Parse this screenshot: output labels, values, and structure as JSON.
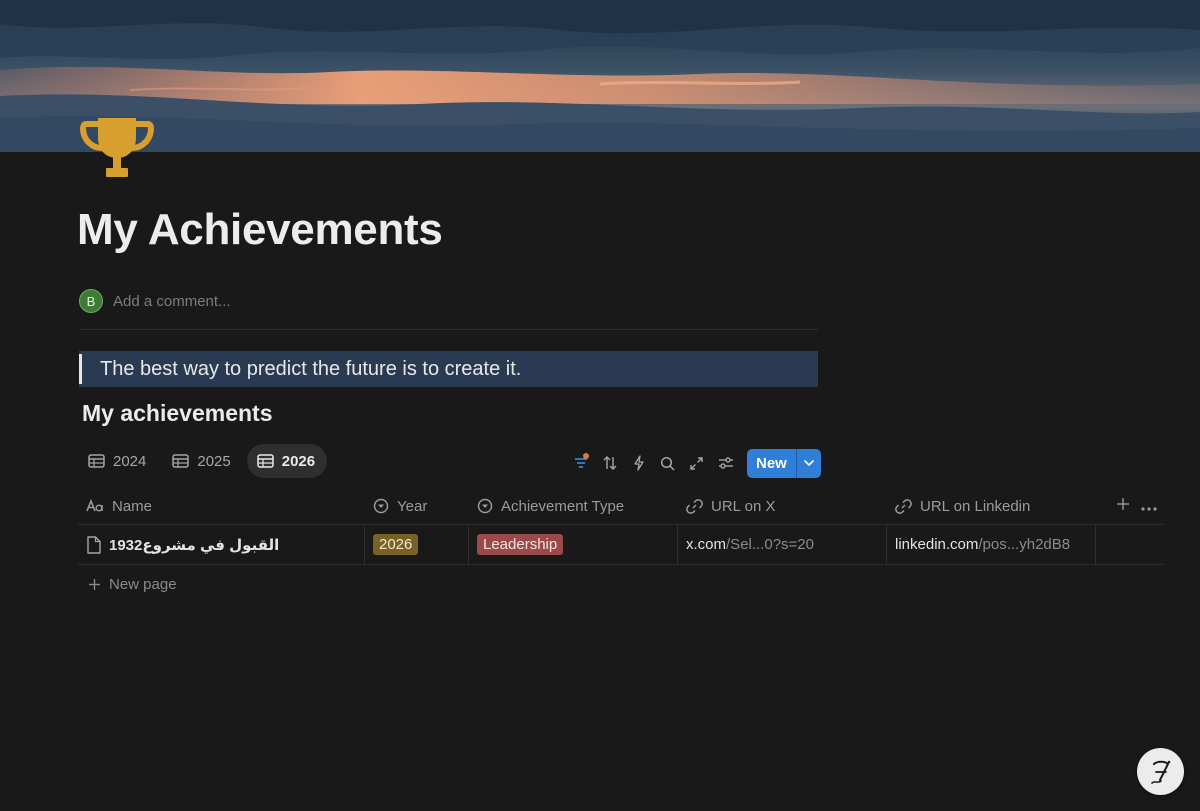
{
  "page": {
    "title": "My Achievements",
    "icon": "trophy-icon"
  },
  "comment": {
    "avatar_letter": "B",
    "placeholder": "Add a comment..."
  },
  "quote": {
    "text": "The best way to predict the future is to create it."
  },
  "database": {
    "title": "My achievements",
    "views": [
      {
        "label": "2024",
        "active": false
      },
      {
        "label": "2025",
        "active": false
      },
      {
        "label": "2026",
        "active": true
      }
    ],
    "toolbar": {
      "new_label": "New"
    },
    "columns": [
      {
        "label": "Name",
        "icon": "text-aa-icon"
      },
      {
        "label": "Year",
        "icon": "select-icon"
      },
      {
        "label": "Achievement Type",
        "icon": "select-icon"
      },
      {
        "label": "URL on X",
        "icon": "link-icon"
      },
      {
        "label": "URL on Linkedin",
        "icon": "link-icon"
      }
    ],
    "rows": [
      {
        "name": "القبول في مشروع1932",
        "year": "2026",
        "type": "Leadership",
        "url_x_host": "x.com",
        "url_x_rest": "/Sel...0?s=20",
        "url_li_host": "linkedin.com",
        "url_li_rest": "/pos...yh2dB8"
      }
    ],
    "new_page_label": "New page"
  },
  "colors": {
    "background": "#191919",
    "accent_blue": "#2f7fd8",
    "year_pill": "#7a6126",
    "type_pill": "#9a4a48",
    "quote_bg": "#2a3a52",
    "filter_dot": "#e07b37"
  }
}
